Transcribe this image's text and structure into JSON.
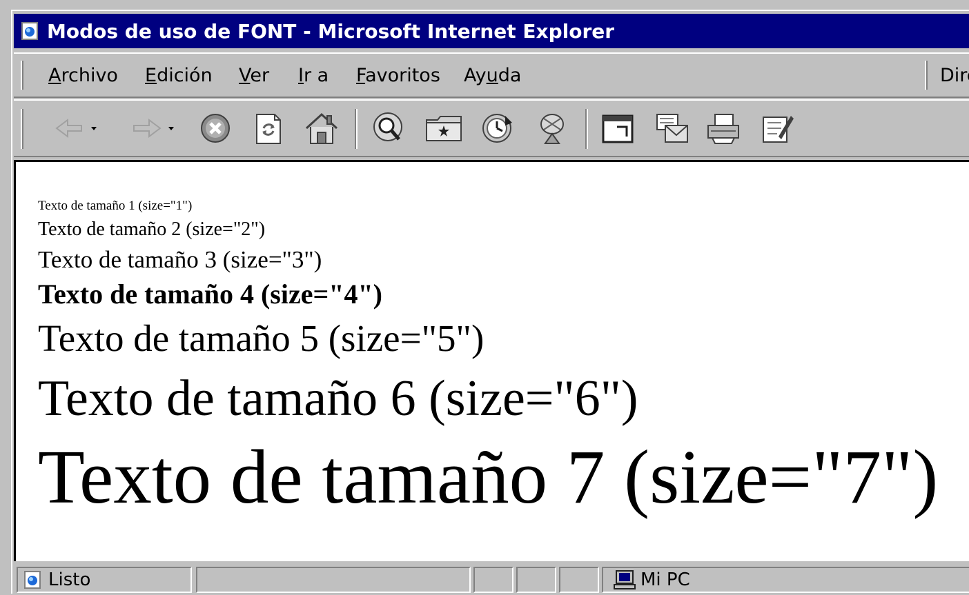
{
  "window": {
    "title": "Modos de uso de FONT - Microsoft Internet Explorer"
  },
  "menu": {
    "items": [
      {
        "pre": "",
        "u": "A",
        "post": "rchivo"
      },
      {
        "pre": "",
        "u": "E",
        "post": "dición"
      },
      {
        "pre": "",
        "u": "V",
        "post": "er"
      },
      {
        "pre": "",
        "u": "I",
        "post": "r a"
      },
      {
        "pre": "",
        "u": "F",
        "post": "avoritos"
      },
      {
        "pre": "Ay",
        "u": "u",
        "post": "da"
      }
    ],
    "address_label": "Dire"
  },
  "toolbar": {
    "buttons": [
      "back-icon",
      "forward-icon",
      "stop-icon",
      "refresh-icon",
      "home-icon",
      "search-icon",
      "favorites-icon",
      "history-icon",
      "channels-icon",
      "fullscreen-icon",
      "mail-icon",
      "print-icon",
      "edit-icon"
    ]
  },
  "content": {
    "lines": [
      "Texto de tamaño 1 (size=\"1\")",
      "Texto de tamaño 2 (size=\"2\")",
      "Texto de tamaño 3 (size=\"3\")",
      "Texto de tamaño 4 (size=\"4\")",
      "Texto de tamaño 5 (size=\"5\")",
      "Texto de tamaño 6 (size=\"6\")",
      "Texto de tamaño 7 (size=\"7\")"
    ]
  },
  "status": {
    "text": "Listo",
    "zone": "Mi PC"
  },
  "colors": {
    "titlebar": "#000080",
    "chrome": "#c0c0c0",
    "page": "#ffffff"
  }
}
